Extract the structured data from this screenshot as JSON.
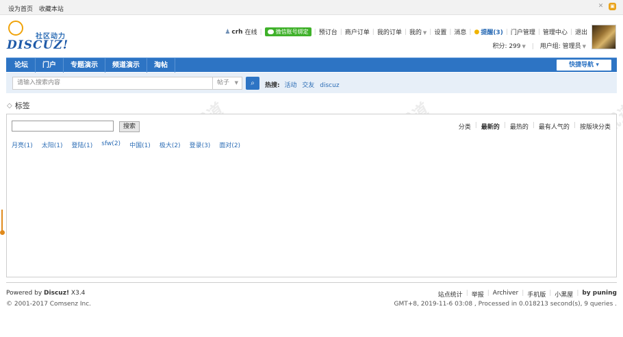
{
  "topbar": {
    "set_home": "设为首页",
    "bookmark": "收藏本站"
  },
  "logo": {
    "slogan": "社区动力",
    "wordmark": "DISCUZ!"
  },
  "user": {
    "name": "crh",
    "status": "在线",
    "wechat_label": "微信账号绑定",
    "links": [
      "预订台",
      "商户订单",
      "我的订单",
      "我的"
    ],
    "settings": "设置",
    "messages": "消息",
    "remind": "提醒(3)",
    "admin_links": [
      "门户管理",
      "管理中心",
      "退出"
    ],
    "points": "积分: 299",
    "group": "用户组: 管理员"
  },
  "nav": {
    "items": [
      "论坛",
      "门户",
      "专题演示",
      "频道演示",
      "淘帖"
    ],
    "quick_nav": "快捷导航"
  },
  "search": {
    "placeholder": "请输入搜索内容",
    "type": "帖子",
    "hot_label": "热搜:",
    "hot_links": [
      "活动",
      "交友",
      "discuz"
    ]
  },
  "breadcrumb": {
    "title": "标签"
  },
  "tags_panel": {
    "search_button": "搜索",
    "filters": [
      "分类",
      "最新的",
      "最热的",
      "最有人气的",
      "按版块分类"
    ],
    "active_filter": "最新的",
    "tags": [
      "月亮(1)",
      "太阳(1)",
      "登陆(1)",
      "sfw(2)",
      "中国(1)",
      "极大(2)",
      "登录(3)",
      "面对(2)"
    ]
  },
  "watermark": {
    "line1": "DISCUZ!应用中心|贰道",
    "line2": "addon.dismall.com"
  },
  "footer": {
    "powered_prefix": "Powered by",
    "powered_name": "Discuz!",
    "version": "X3.4",
    "copyright": "© 2001-2017 Comsenz Inc.",
    "links": [
      "站点统计",
      "举报",
      "Archiver",
      "手机版",
      "小黑屋"
    ],
    "by": "by puning",
    "stats": "GMT+8, 2019-11-6 03:08 , Processed in 0.018213 second(s), 9 queries ."
  },
  "colors": {
    "nav_blue": "#2d74c4",
    "link_blue": "#2b6cb5",
    "wechat_green": "#3fb12a"
  }
}
